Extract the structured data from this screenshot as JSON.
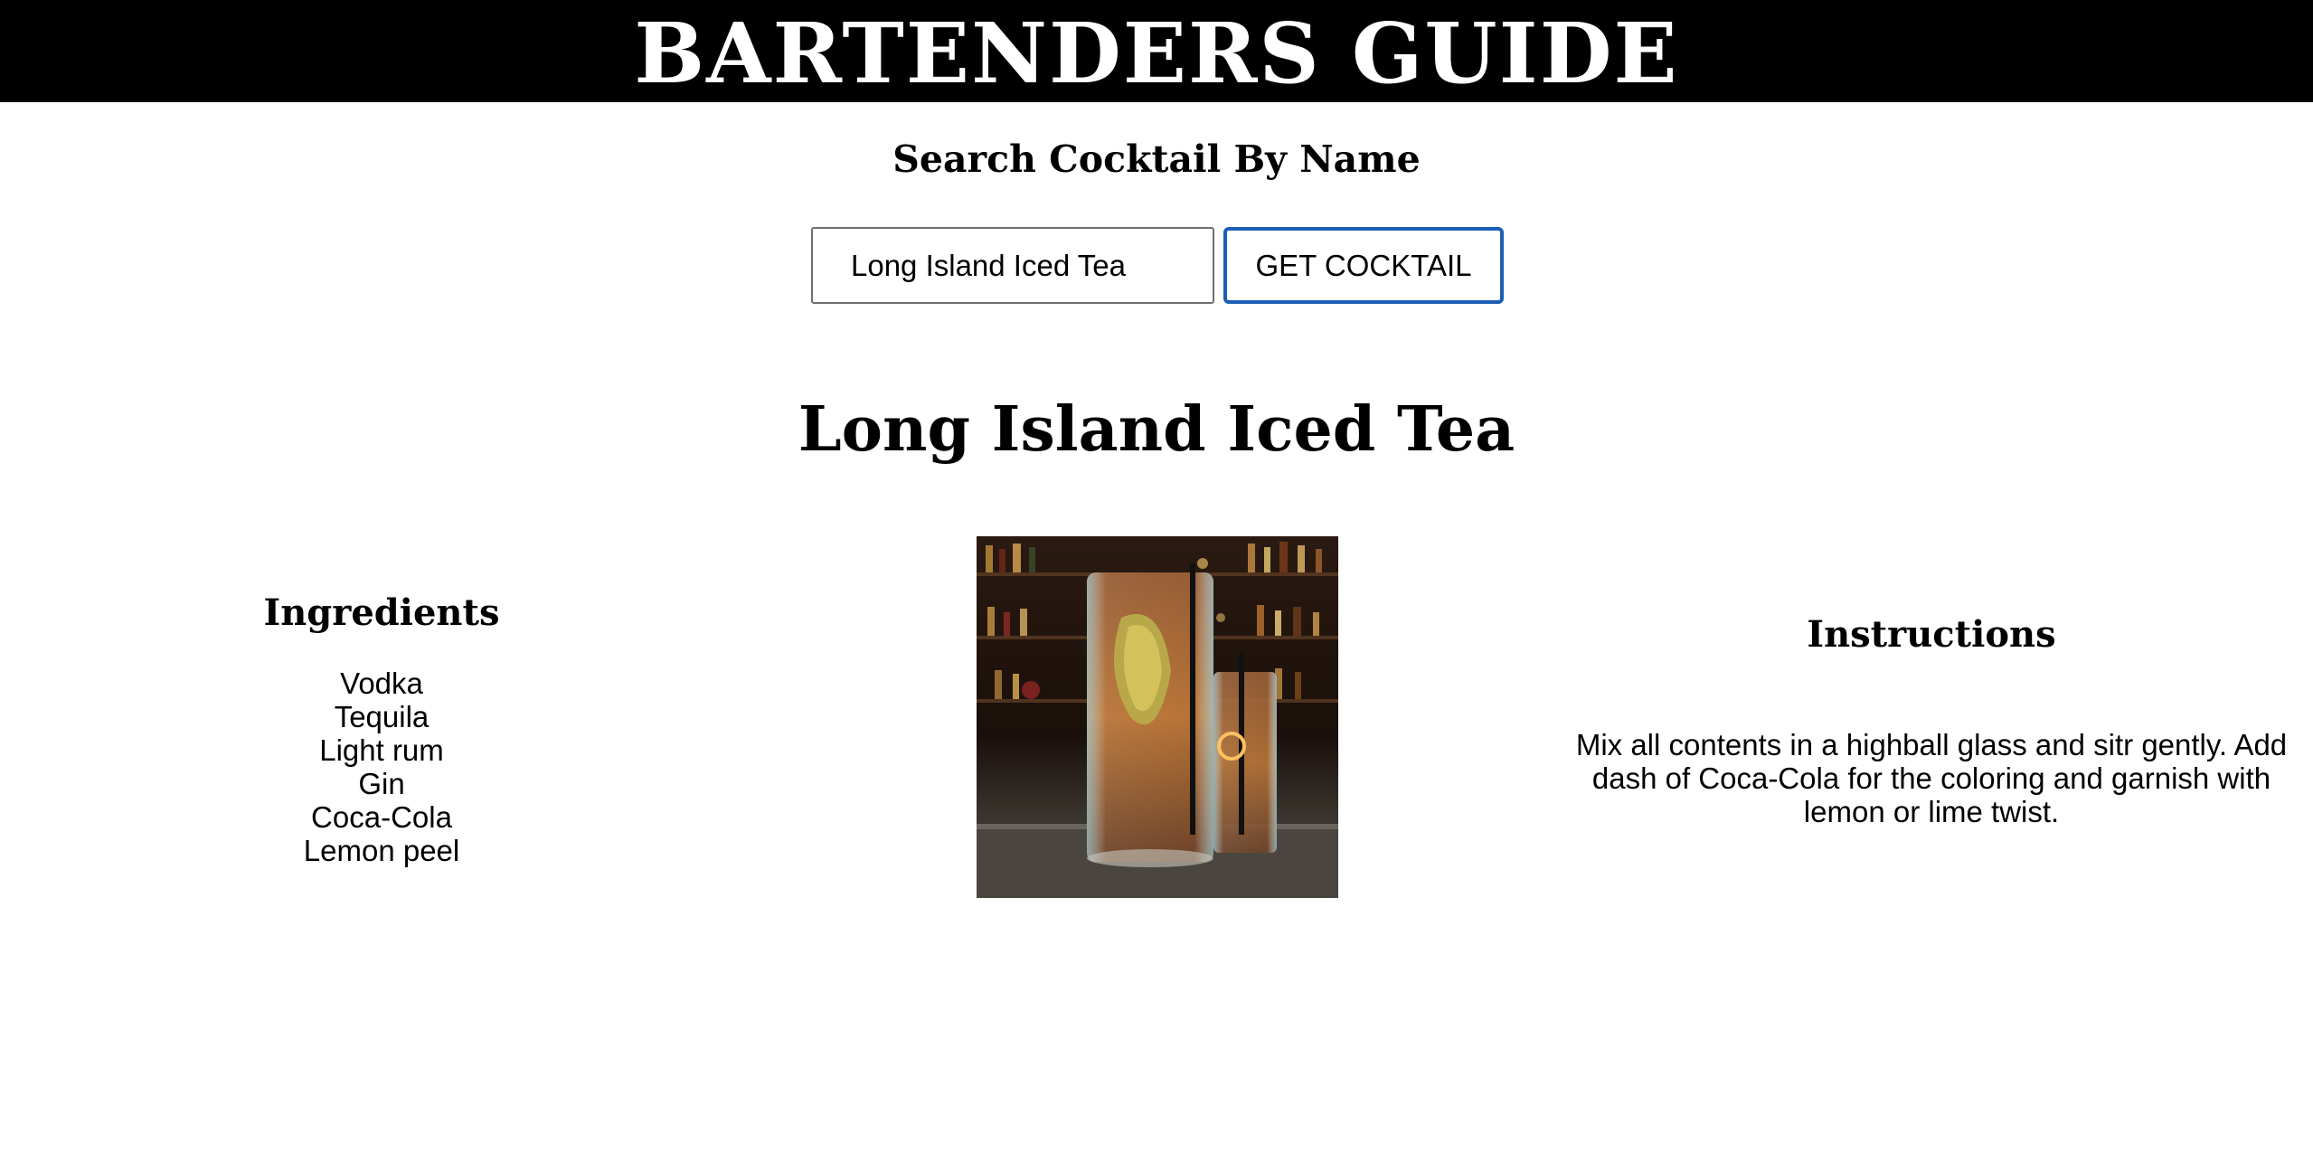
{
  "header": {
    "title": "BARTENDERS GUIDE"
  },
  "search": {
    "heading": "Search Cocktail By Name",
    "input_value": "Long Island Iced Tea",
    "button_label": "GET COCKTAIL",
    "button_border_color": "#1a5fb4"
  },
  "cocktail": {
    "name": "Long Island Iced Tea",
    "ingredients_heading": "Ingredients",
    "ingredients": [
      "Vodka",
      "Tequila",
      "Light rum",
      "Gin",
      "Coca-Cola",
      "Lemon peel"
    ],
    "instructions_heading": "Instructions",
    "instructions": "Mix all contents in a highball glass and sitr gently. Add dash of Coca-Cola for the coloring and garnish with lemon or lime twist."
  },
  "colors": {
    "header_bg": "#000000",
    "header_text": "#ffffff",
    "page_bg": "#ffffff"
  }
}
